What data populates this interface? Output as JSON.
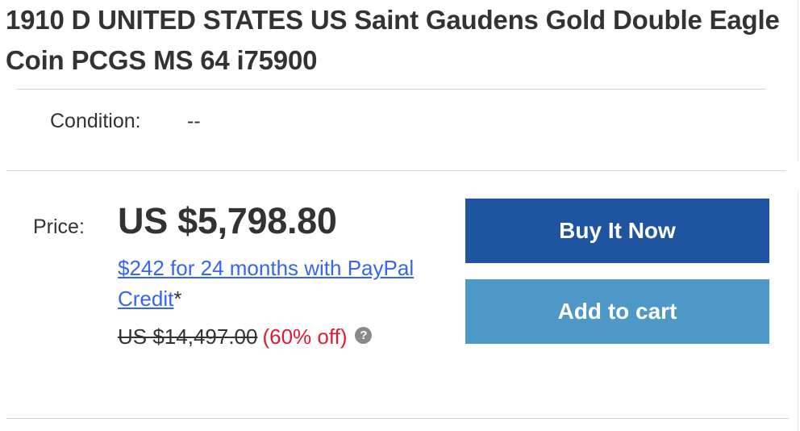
{
  "listing": {
    "title": "1910 D UNITED STATES US Saint Gaudens Gold Double Eagle Coin PCGS MS 64 i75900"
  },
  "condition": {
    "label": "Condition:",
    "value": "--"
  },
  "price": {
    "label": "Price:",
    "value": "US $5,798.80",
    "financing_link": "$242 for 24 months with PayPal Credit",
    "financing_asterisk": "*",
    "original_price": "US $14,497.00",
    "discount": "(60% off)",
    "help_icon": "?"
  },
  "actions": {
    "buy_now_label": "Buy It Now",
    "add_to_cart_label": "Add to cart"
  },
  "colors": {
    "buy_now_bg": "#1f54a0",
    "add_to_cart_bg": "#4d98c7",
    "link": "#3665f3",
    "discount": "#dd1e31",
    "text": "#333333"
  }
}
